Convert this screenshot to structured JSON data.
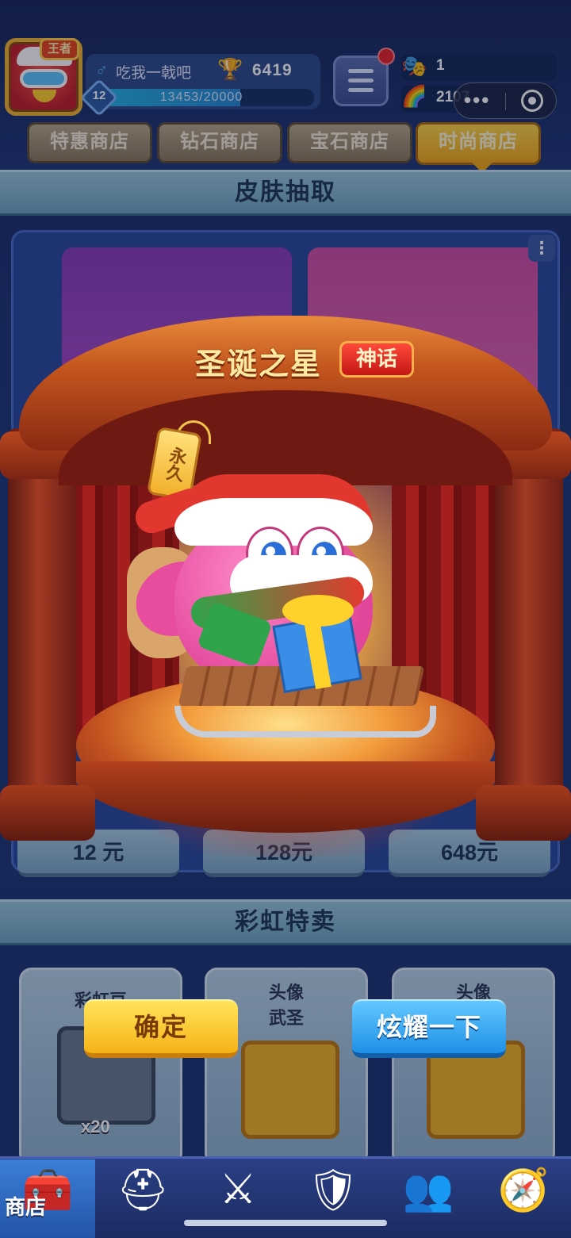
{
  "header": {
    "crown_badge": "王者",
    "player_name": "吃我一戟吧",
    "trophies": "6419",
    "level": "12",
    "xp_text": "13453/20000",
    "xp_progress": 0.67265,
    "currencies": [
      {
        "icon": "mask-icon",
        "value": "1"
      },
      {
        "icon": "rainbow-gem-icon",
        "value": "2107"
      }
    ],
    "capsule_dots": "•••"
  },
  "tabs": [
    {
      "label": "特惠商店",
      "active": false
    },
    {
      "label": "钻石商店",
      "active": false
    },
    {
      "label": "宝石商店",
      "active": false
    },
    {
      "label": "时尚商店",
      "active": true
    }
  ],
  "skin_draw": {
    "title": "皮肤抽取",
    "prices": [
      "12 元",
      "128元",
      "648元"
    ]
  },
  "rainbow_sale": {
    "title": "彩虹特卖",
    "items": [
      {
        "title": "彩虹豆",
        "qty": "x20"
      },
      {
        "title_line1": "头像",
        "title_line2": "武圣"
      },
      {
        "title_line1": "头像",
        "title_line2": ""
      }
    ]
  },
  "reward_modal": {
    "name": "圣诞之星",
    "rarity": "神话",
    "tag": "永久",
    "confirm_label": "确定",
    "share_label": "炫耀一下"
  },
  "nav": {
    "items": [
      {
        "icon": "treasure-chest-icon",
        "label": "商店",
        "active": true
      },
      {
        "icon": "knight-helmet-icon",
        "active": false
      },
      {
        "icon": "crossed-swords-icon",
        "active": false
      },
      {
        "icon": "crown-shield-icon",
        "active": false
      },
      {
        "icon": "team-banner-icon",
        "active": false
      },
      {
        "icon": "compass-icon",
        "active": false
      }
    ]
  },
  "colors": {
    "background": "#213b7c",
    "tab_active": "#f3a91b",
    "confirm_button": "#f6b217",
    "share_button": "#1f8fe6",
    "rarity_badge": "#c41616"
  }
}
